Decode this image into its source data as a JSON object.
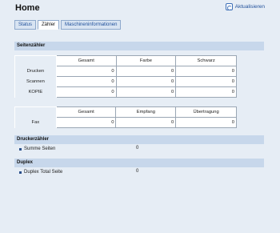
{
  "header": {
    "title": "Home",
    "refresh_label": "Aktualisieren"
  },
  "tabs": [
    {
      "label": "Status",
      "active": false
    },
    {
      "label": "Zähler",
      "active": true
    },
    {
      "label": "Maschineninformationen",
      "active": false
    }
  ],
  "seitenzaehler": {
    "title": "Seitenzähler",
    "columns": [
      "Gesamt",
      "Farbe",
      "Schwarz"
    ],
    "rows": [
      {
        "label": "Drucken",
        "values": [
          "0",
          "0",
          "0"
        ]
      },
      {
        "label": "Scannen",
        "values": [
          "0",
          "0",
          "0"
        ]
      },
      {
        "label": "KOPIE",
        "values": [
          "0",
          "0",
          "0"
        ]
      }
    ]
  },
  "fax": {
    "columns": [
      "Gesamt",
      "Empfang",
      "Übertragung"
    ],
    "rows": [
      {
        "label": "Fax",
        "values": [
          "0",
          "0",
          "0"
        ]
      }
    ]
  },
  "druckerzaehler": {
    "title": "Druckerzähler",
    "items": [
      {
        "label": "Summe Seiten",
        "value": "0"
      }
    ]
  },
  "duplex": {
    "title": "Duplex",
    "items": [
      {
        "label": "Duplex Total Seite",
        "value": "0"
      }
    ]
  }
}
